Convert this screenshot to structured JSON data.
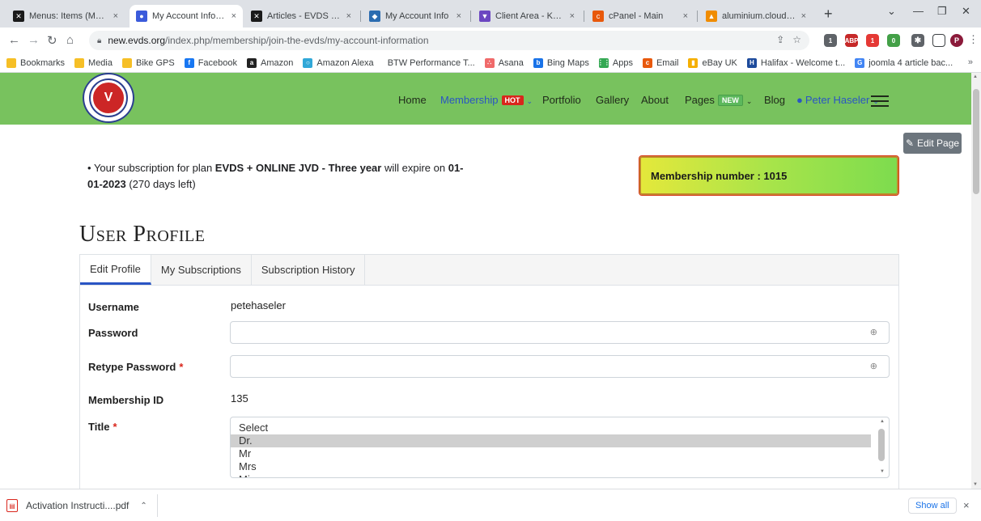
{
  "browser": {
    "tabs": [
      {
        "label": "Menus: Items (Main M",
        "color": "#1a1a1a",
        "glyph": "✕"
      },
      {
        "label": "My Account Informat",
        "color": "#3b5bdb",
        "glyph": "●",
        "active": true
      },
      {
        "label": "Articles - EVDS - Adm",
        "color": "#1a1a1a",
        "glyph": "✕"
      },
      {
        "label": "My Account Info",
        "color": "#2b6cb0",
        "glyph": "◆"
      },
      {
        "label": "Client Area - Krystal H",
        "color": "#6b46c1",
        "glyph": "▼"
      },
      {
        "label": "cPanel - Main",
        "color": "#e8590c",
        "glyph": "c"
      },
      {
        "label": "aluminium.cloudhost",
        "color": "#f08c00",
        "glyph": "▲"
      }
    ],
    "tab_close": "×",
    "new_tab": "+",
    "window_controls": {
      "dropdown": "⌄",
      "minimize": "—",
      "restore": "❐",
      "close": "✕"
    },
    "url_host": "new.evds.org",
    "url_path": "/index.php/membership/join-the-evds/my-account-information",
    "omnibox_icons": {
      "share": "⇪",
      "star": "☆"
    },
    "profile_initial": "P",
    "extensions": [
      {
        "label": "1",
        "color": "#5f6368"
      },
      {
        "label": "ABP",
        "color": "#c62828"
      },
      {
        "label": "1",
        "color": "#e53935"
      },
      {
        "label": "0",
        "color": "#43a047"
      }
    ],
    "bookmarks": [
      {
        "label": "Bookmarks",
        "color": "#f6bf26",
        "glyph": ""
      },
      {
        "label": "Media",
        "color": "#f6bf26",
        "glyph": ""
      },
      {
        "label": "Bike GPS",
        "color": "#f6bf26",
        "glyph": ""
      },
      {
        "label": "Facebook",
        "color": "#1877f2",
        "glyph": "f"
      },
      {
        "label": "Amazon",
        "color": "#222222",
        "glyph": "a"
      },
      {
        "label": "Amazon Alexa",
        "color": "#31a8d8",
        "glyph": "○"
      },
      {
        "label": "BTW Performance T...",
        "color": "#ffffff",
        "glyph": ""
      },
      {
        "label": "Asana",
        "color": "#f06a6a",
        "glyph": "∴"
      },
      {
        "label": "Bing Maps",
        "color": "#1a73e8",
        "glyph": "b"
      },
      {
        "label": "Apps",
        "color": "#34a853",
        "glyph": "⋮⋮"
      },
      {
        "label": "Email",
        "color": "#e8590c",
        "glyph": "c"
      },
      {
        "label": "eBay UK",
        "color": "#f5af02",
        "glyph": "▮"
      },
      {
        "label": "Halifax - Welcome t...",
        "color": "#1e4b9c",
        "glyph": "H"
      },
      {
        "label": "joomla 4 article bac...",
        "color": "#4285f4",
        "glyph": "G"
      }
    ],
    "bookmarks_more": "»"
  },
  "site": {
    "logo_text": "V",
    "nav": [
      {
        "label": "Home"
      },
      {
        "label": "Membership",
        "badge": "HOT",
        "active": true,
        "caret": true
      },
      {
        "label": "Portfolio"
      },
      {
        "label": "Gallery"
      },
      {
        "label": "About"
      },
      {
        "label": "Pages",
        "badge": "NEW",
        "caret": true
      },
      {
        "label": "Blog"
      },
      {
        "label": "Peter Haseler",
        "active": true,
        "caret": true,
        "icon": "user-circle"
      }
    ]
  },
  "page": {
    "edit_page": "Edit Page",
    "subscription": {
      "prefix": "Your subscription for plan ",
      "plan": "EVDS + ONLINE JVD - Three year",
      "middle": " will expire on ",
      "date": "01-01-2023",
      "suffix": " (270 days left)"
    },
    "membership_number": "Membership number : 1015",
    "heading": "User Profile",
    "tabs": [
      "Edit Profile",
      "My Subscriptions",
      "Subscription History"
    ],
    "form": {
      "username_label": "Username",
      "username_value": "petehaseler",
      "password_label": "Password",
      "password_value": "",
      "retype_label": "Retype Password",
      "retype_value": "",
      "membership_id_label": "Membership ID",
      "membership_id_value": "135",
      "title_label": "Title",
      "required_mark": "*",
      "title_options": [
        "Select",
        "Dr.",
        "Mr",
        "Mrs",
        "Miss"
      ],
      "title_selected": "Dr."
    }
  },
  "downloads": {
    "file": "Activation Instructi....pdf",
    "show_all": "Show all",
    "close": "×"
  }
}
